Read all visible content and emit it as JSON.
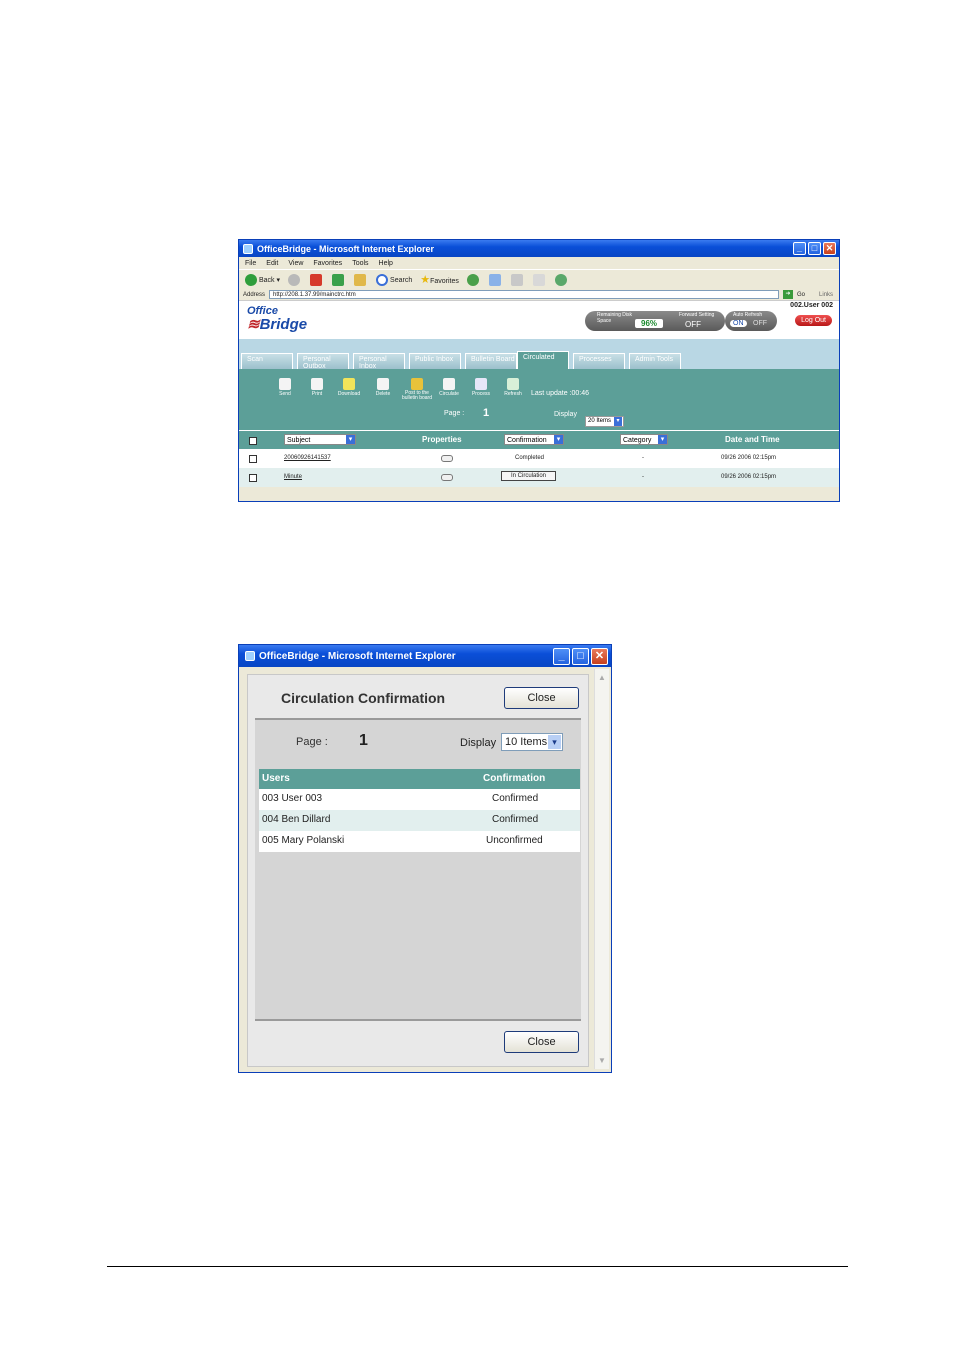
{
  "main_window": {
    "title": "OfficeBridge - Microsoft Internet Explorer",
    "menu": [
      "File",
      "Edit",
      "View",
      "Favorites",
      "Tools",
      "Help"
    ],
    "toolbar": {
      "back": "Back",
      "search": "Search",
      "favorites": "Favorites"
    },
    "address_label": "Address",
    "address_value": "http://208.1.37.99/mainctrc.htm",
    "go": "Go",
    "links": "Links",
    "app": {
      "logo_line1": "Office",
      "logo_line2": "Bridge",
      "remaining_label": "Remaining Disk Space",
      "remaining_value": "96%",
      "forward_label": "Forward Setting",
      "forward_value": "OFF",
      "auto_refresh_label": "Auto Refresh",
      "auto_on": "ON",
      "auto_off": "OFF",
      "user": "002.User 002",
      "logout": "Log Out"
    },
    "tabs": [
      "Scan",
      "Personal Outbox",
      "Personal Inbox",
      "Public Inbox",
      "Bulletin Board",
      "Circulated",
      "Processes",
      "Admin Tools"
    ],
    "active_tab": "Circulated",
    "actions": [
      "Send",
      "Print",
      "Download",
      "Delete",
      "Post to the bulletin board",
      "Circulate",
      "Process",
      "Refresh"
    ],
    "last_update": "Last update :00:46",
    "page_label": "Page :",
    "page_number": "1",
    "display_label": "Display",
    "display_value": "20 Items",
    "grid": {
      "headers": {
        "subject": "Subject",
        "properties": "Properties",
        "confirmation": "Confirmation",
        "category": "Category",
        "date": "Date and Time"
      },
      "rows": [
        {
          "subject": "20060926141537",
          "confirmation": "Completed",
          "category": "-",
          "date": "09/26 2006 02:15pm"
        },
        {
          "subject": "Minute",
          "confirmation": "In Circulation",
          "category": "-",
          "date": "09/26 2006 02:15pm"
        }
      ]
    }
  },
  "popup_window": {
    "title": "OfficeBridge - Microsoft Internet Explorer",
    "heading": "Circulation Confirmation",
    "close_label": "Close",
    "page_label": "Page :",
    "page_number": "1",
    "display_label": "Display",
    "display_value": "10 Items",
    "table": {
      "headers": {
        "users": "Users",
        "confirmation": "Confirmation"
      },
      "rows": [
        {
          "user": "003 User 003",
          "status": "Confirmed"
        },
        {
          "user": "004 Ben Dillard",
          "status": "Confirmed"
        },
        {
          "user": "005 Mary Polanski",
          "status": "Unconfirmed"
        }
      ]
    }
  },
  "colors": {
    "teal": "#5c9f98",
    "xp_blue": "#0a4fd8",
    "row_alt": "#e2efee"
  }
}
